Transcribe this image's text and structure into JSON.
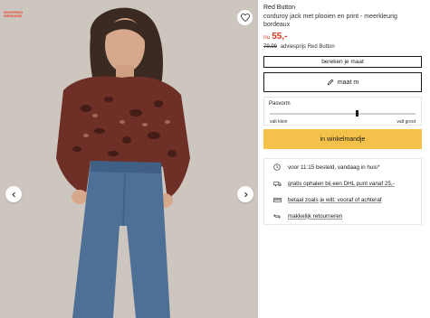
{
  "gallery": {
    "promo_tag": "SHOPPING WEEKEND",
    "wishlist_icon": "heart-outline-icon",
    "prev_icon": "chevron-left-icon",
    "next_icon": "chevron-right-icon"
  },
  "product": {
    "brand": "Red Button",
    "title": "corduroy jack met plooien en print - meerkleurig bordeaux",
    "price_prefix": "nu",
    "price": "55,-",
    "advies_price": "79,99",
    "advies_text": "adviesprijs Red Button"
  },
  "actions": {
    "calc_size": "bereken je maat",
    "size_label": "maat m",
    "size_icon": "pencil-icon",
    "add_to_cart": "in winkelmandje"
  },
  "fit": {
    "label": "Pasvorm",
    "min_label": "valt klein",
    "max_label": "valt groot",
    "level": 0.6
  },
  "usps": [
    {
      "icon": "clock-icon",
      "text": "voor 11:15 besteld, vandaag in huis*",
      "link": false
    },
    {
      "icon": "truck-icon",
      "text": "gratis ophalen bij een DHL punt vanaf 25,-",
      "link": true
    },
    {
      "icon": "card-icon",
      "text": "betaal zoals je wilt: vooraf of achteraf",
      "link": true
    },
    {
      "icon": "return-icon",
      "text": "makkelijk retourneren",
      "link": true
    }
  ],
  "colors": {
    "price": "#d6361f",
    "cart_button": "#f4c24b"
  }
}
